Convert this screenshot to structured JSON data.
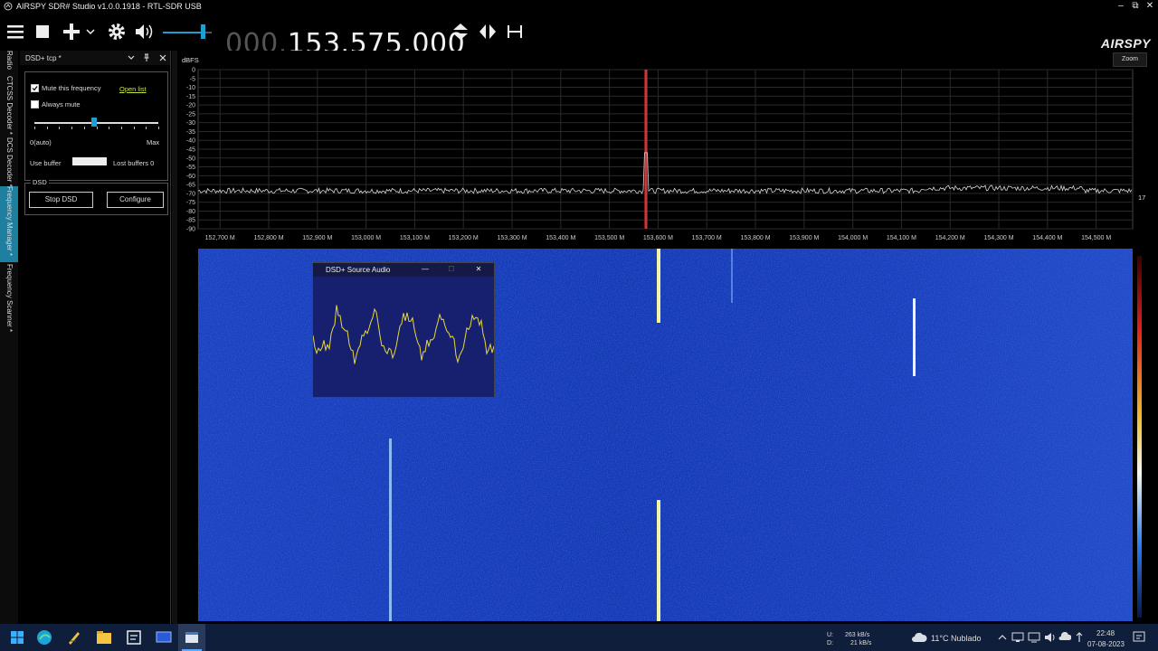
{
  "window": {
    "title": "AIRSPY SDR# Studio v1.0.0.1918 - RTL-SDR USB",
    "controls": [
      "–",
      "⧉",
      "✕"
    ]
  },
  "toolbar": {
    "frequency_dim": "000.",
    "frequency": "153.575.000",
    "logo": "AIRSPY",
    "volume_level": 0.82
  },
  "left_tabs": [
    {
      "label": "Radio",
      "active": false
    },
    {
      "label": "CTCSS Decoder *",
      "active": false
    },
    {
      "label": "DCS Decoder *",
      "active": false
    },
    {
      "label": "Frequency Manager *",
      "active": true
    },
    {
      "label": "Frequency Scanner *",
      "active": false
    }
  ],
  "panel": {
    "title": "DSD+ tcp *",
    "mute_label": "Mute this frequency",
    "open_list": "Open list",
    "always_mute_label": "Always mute",
    "slider_min": "0(auto)",
    "slider_max": "Max",
    "slider_value": 0.48,
    "use_buffer_label": "Use buffer",
    "lost_buffers": "Lost buffers 0",
    "dsd_group": "DSD",
    "stop_button": "Stop DSD",
    "configure_button": "Configure"
  },
  "spectrum": {
    "unit": "dBFS",
    "zoom_label": "Zoom",
    "right_value": "17",
    "y_ticks": [
      "0",
      "-5",
      "-10",
      "-15",
      "-20",
      "-25",
      "-30",
      "-35",
      "-40",
      "-45",
      "-50",
      "-55",
      "-60",
      "-65",
      "-70",
      "-75",
      "-80",
      "-85",
      "-90"
    ],
    "x_ticks": [
      "152,700 M",
      "152,800 M",
      "152,900 M",
      "153,000 M",
      "153,100 M",
      "153,200 M",
      "153,300 M",
      "153,400 M",
      "153,500 M",
      "153,600 M",
      "153,700 M",
      "153,800 M",
      "153,900 M",
      "154,000 M",
      "154,100 M",
      "154,200 M",
      "154,300 M",
      "154,400 M",
      "154,500 M"
    ]
  },
  "popup": {
    "title": "DSD+ Source Audio",
    "controls": [
      "—",
      "☐",
      "✕"
    ]
  },
  "taskbar": {
    "net_up_label": "U:",
    "net_up": "263 kB/s",
    "net_down_label": "D:",
    "net_down": "21 kB/s",
    "weather": "11°C  Nublado",
    "time": "22:48",
    "date": "07-08-2023"
  },
  "colors": {
    "accent": "#1f7fa1",
    "waterfall": "#1a3fc8",
    "trace": "#e8d83a",
    "spectrum_trace": "#d8d8d8",
    "taskbar": "#0f1e3a"
  }
}
